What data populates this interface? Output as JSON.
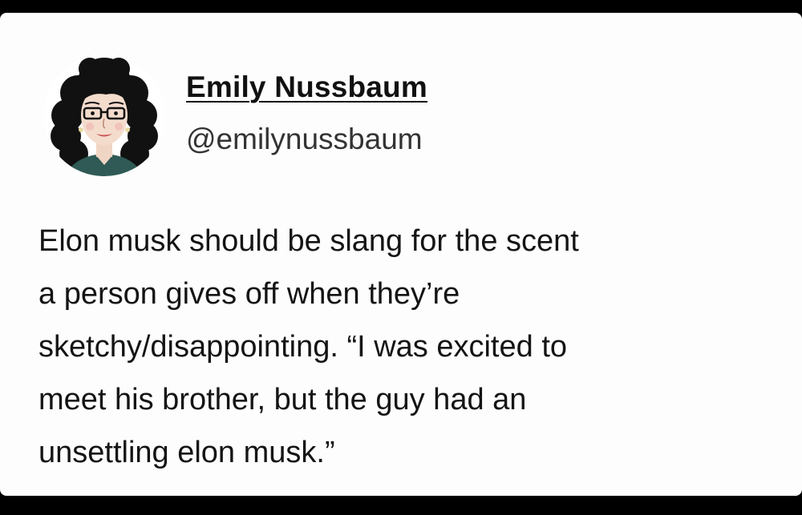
{
  "tweet": {
    "author": {
      "display_name": "Emily Nussbaum",
      "handle": "@emilynussbaum",
      "avatar_icon": "cartoon-portrait-avatar"
    },
    "text_lines": [
      "Elon musk should be slang for the scent",
      "a person gives off when they’re",
      "sketchy/disappointing. “I was excited to",
      "meet his brother, but the guy had an",
      "unsettling elon musk.”"
    ]
  },
  "colors": {
    "background": "#fdfdfd",
    "outer_frame": "#000000",
    "text": "#141414"
  }
}
